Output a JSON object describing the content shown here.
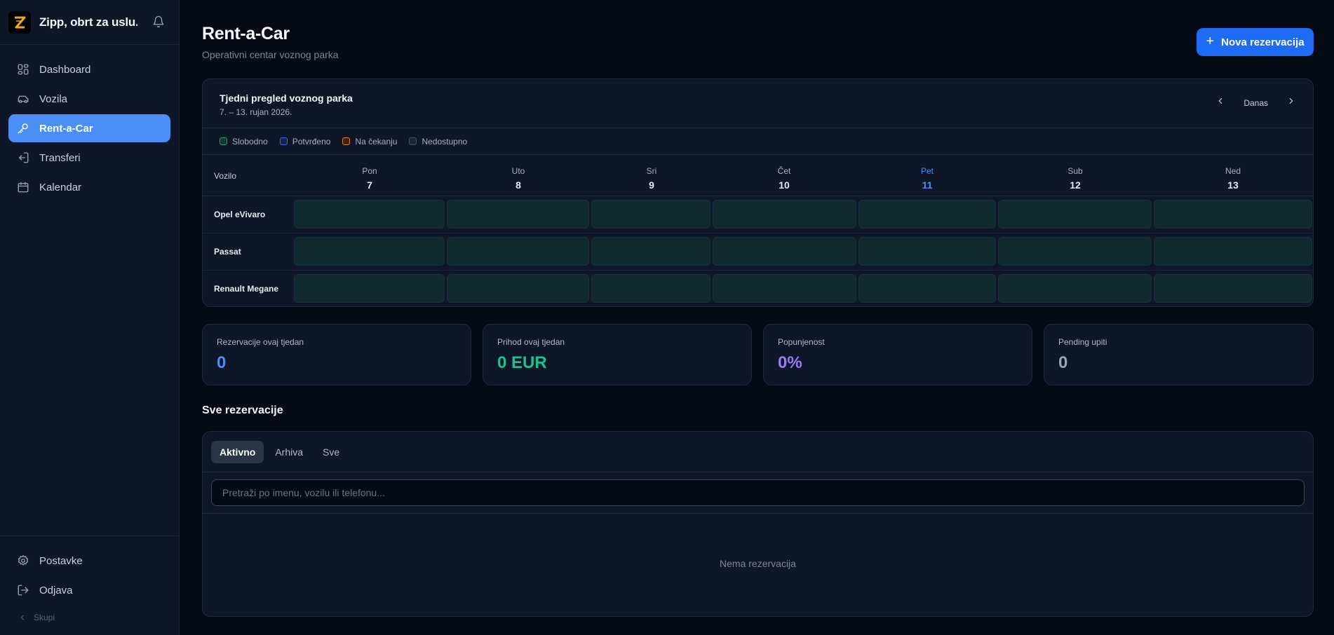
{
  "brand": {
    "name": "Zipp, obrt za uslu...",
    "logo_letter": "Z"
  },
  "nav": {
    "items": [
      {
        "label": "Dashboard",
        "icon": "grid-icon"
      },
      {
        "label": "Vozila",
        "icon": "car-icon"
      },
      {
        "label": "Rent-a-Car",
        "icon": "key-icon",
        "active": true
      },
      {
        "label": "Transferi",
        "icon": "transfer-icon"
      },
      {
        "label": "Kalendar",
        "icon": "calendar-icon"
      }
    ],
    "bottom": [
      {
        "label": "Postavke",
        "icon": "gear-icon"
      },
      {
        "label": "Odjava",
        "icon": "logout-icon"
      }
    ],
    "collapse_label": "Skupi"
  },
  "header": {
    "title": "Rent-a-Car",
    "subtitle": "Operativni centar voznog parka",
    "new_button": "Nova rezervacija"
  },
  "fleet": {
    "title": "Tjedni pregled voznog parka",
    "range": "7. – 13. rujan 2026.",
    "today_label": "Danas",
    "legend": [
      {
        "label": "Slobodno",
        "color": "#12a37a"
      },
      {
        "label": "Potvrđeno",
        "color": "#2f6fe4"
      },
      {
        "label": "Na čekanju",
        "color": "#e07a2f"
      },
      {
        "label": "Nedostupno",
        "color": "#4a5568"
      }
    ],
    "vehicle_col": "Vozilo",
    "days": [
      {
        "name": "Pon",
        "date": "7"
      },
      {
        "name": "Uto",
        "date": "8"
      },
      {
        "name": "Sri",
        "date": "9"
      },
      {
        "name": "Čet",
        "date": "10"
      },
      {
        "name": "Pet",
        "date": "11",
        "today": true
      },
      {
        "name": "Sub",
        "date": "12"
      },
      {
        "name": "Ned",
        "date": "13"
      }
    ],
    "vehicles": [
      {
        "name": "Opel eVivaro",
        "status": [
          "Slobodno",
          "Slobodno",
          "Slobodno",
          "Slobodno",
          "Slobodno",
          "Slobodno",
          "Slobodno"
        ]
      },
      {
        "name": "Passat",
        "status": [
          "Slobodno",
          "Slobodno",
          "Slobodno",
          "Slobodno",
          "Slobodno",
          "Slobodno",
          "Slobodno"
        ]
      },
      {
        "name": "Renault Megane",
        "status": [
          "Slobodno",
          "Slobodno",
          "Slobodno",
          "Slobodno",
          "Slobodno",
          "Slobodno",
          "Slobodno"
        ]
      }
    ]
  },
  "stats": [
    {
      "label": "Rezervacije ovaj tjedan",
      "value": "0",
      "color": "#4b8ef7"
    },
    {
      "label": "Prihod ovaj tjedan",
      "value": "0 EUR",
      "color": "#19c38d"
    },
    {
      "label": "Popunjenost",
      "value": "0%",
      "color": "#9b7bf5"
    },
    {
      "label": "Pending upiti",
      "value": "0",
      "color": "#9aa4b2"
    }
  ],
  "reservations": {
    "section_title": "Sve rezervacije",
    "tabs": [
      {
        "label": "Aktivno",
        "active": true
      },
      {
        "label": "Arhiva"
      },
      {
        "label": "Sve"
      }
    ],
    "search_placeholder": "Pretraži po imenu, vozilu ili telefonu...",
    "search_value": "",
    "empty_text": "Nema rezervacija"
  }
}
